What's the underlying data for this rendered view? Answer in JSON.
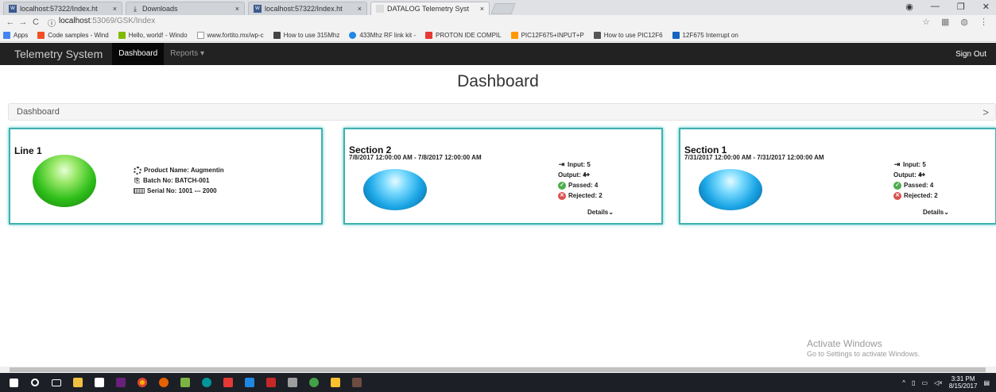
{
  "browser": {
    "tabs": [
      {
        "title": "localhost:57322/Index.ht",
        "active": false
      },
      {
        "title": "Downloads",
        "active": false
      },
      {
        "title": "localhost:57322/Index.ht",
        "active": false
      },
      {
        "title": "DATALOG Telemetry Syst",
        "active": true
      }
    ],
    "url_host": "localhost",
    "url_path": ":53069/GSK/Index",
    "bookmarks": [
      {
        "label": "Apps",
        "color": "#4285f4"
      },
      {
        "label": "Code samples - Wind",
        "color": "#f25022"
      },
      {
        "label": "Hello, world! - Windo",
        "color": "#7fba00"
      },
      {
        "label": "www.fortito.mx/wp-c",
        "color": "#999999"
      },
      {
        "label": "How to use 315Mhz",
        "color": "#444444"
      },
      {
        "label": "433Mhz RF link kit -",
        "color": "#1e88e5"
      },
      {
        "label": "PROTON IDE COMPIL",
        "color": "#e53935"
      },
      {
        "label": "PIC12F675+INPUT+P",
        "color": "#ff9800"
      },
      {
        "label": "How to use PIC12F6",
        "color": "#555555"
      },
      {
        "label": "12F675 Interrupt on",
        "color": "#1565c0"
      }
    ]
  },
  "navbar": {
    "brand": "Telemetry System",
    "items": [
      {
        "label": "Dashboard",
        "active": true
      },
      {
        "label": "Reports ▾",
        "active": false
      }
    ],
    "signout": "Sign Out"
  },
  "page": {
    "title": "Dashboard",
    "breadcrumb": "Dashboard"
  },
  "cards": {
    "line1": {
      "title": "Line 1",
      "product": "Product Name: Augmentin",
      "batch": "Batch No: BATCH-001",
      "serial": "Serial No: 1001 --- 2000"
    },
    "section2": {
      "title": "Section 2",
      "daterange": "7/8/2017 12:00:00 AM - 7/8/2017 12:00:00 AM",
      "input": "Input: 5",
      "output": "Output: 4",
      "passed": "Passed: 4",
      "rejected": "Rejected: 2",
      "details": "Details"
    },
    "section1": {
      "title": "Section 1",
      "daterange": "7/31/2017 12:00:00 AM - 7/31/2017 12:00:00 AM",
      "input": "Input: 5",
      "output": "Output: 4",
      "passed": "Passed: 4",
      "rejected": "Rejected: 2",
      "details": "Details"
    }
  },
  "watermark": {
    "line1": "Activate Windows",
    "line2": "Go to Settings to activate Windows."
  },
  "taskbar": {
    "time": "3:31 PM",
    "date": "8/15/2017"
  },
  "colors": {
    "card_border": "#3fb0b0",
    "navbar_bg": "#222222",
    "status_green": "#2fbf1a",
    "status_blue": "#1ba6e6"
  }
}
